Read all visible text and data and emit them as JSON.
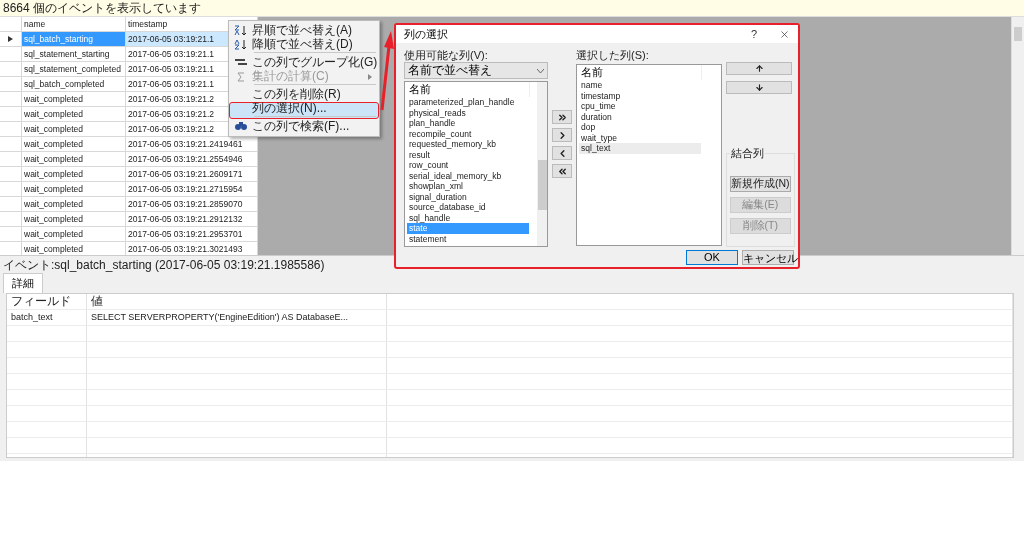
{
  "status_text": "8664 個のイベントを表示しています",
  "grid": {
    "columns": [
      "name",
      "timestamp"
    ],
    "rows": [
      {
        "name": "sql_batch_starting",
        "timestamp": "2017-06-05 03:19:21.1",
        "selected": true
      },
      {
        "name": "sql_statement_starting",
        "timestamp": "2017-06-05 03:19:21.1",
        "selected": false
      },
      {
        "name": "sql_statement_completed",
        "timestamp": "2017-06-05 03:19:21.1",
        "selected": false
      },
      {
        "name": "sql_batch_completed",
        "timestamp": "2017-06-05 03:19:21.1",
        "selected": false
      },
      {
        "name": "wait_completed",
        "timestamp": "2017-06-05 03:19:21.2",
        "selected": false
      },
      {
        "name": "wait_completed",
        "timestamp": "2017-06-05 03:19:21.2",
        "selected": false
      },
      {
        "name": "wait_completed",
        "timestamp": "2017-06-05 03:19:21.2",
        "selected": false
      },
      {
        "name": "wait_completed",
        "timestamp": "2017-06-05 03:19:21.2419461",
        "selected": false
      },
      {
        "name": "wait_completed",
        "timestamp": "2017-06-05 03:19:21.2554946",
        "selected": false
      },
      {
        "name": "wait_completed",
        "timestamp": "2017-06-05 03:19:21.2609171",
        "selected": false
      },
      {
        "name": "wait_completed",
        "timestamp": "2017-06-05 03:19:21.2715954",
        "selected": false
      },
      {
        "name": "wait_completed",
        "timestamp": "2017-06-05 03:19:21.2859070",
        "selected": false
      },
      {
        "name": "wait_completed",
        "timestamp": "2017-06-05 03:19:21.2912132",
        "selected": false
      },
      {
        "name": "wait_completed",
        "timestamp": "2017-06-05 03:19:21.2953701",
        "selected": false
      },
      {
        "name": "wait_completed",
        "timestamp": "2017-06-05 03:19:21.3021493",
        "selected": false
      }
    ]
  },
  "context_menu": {
    "items": [
      {
        "kind": "sort-asc",
        "label": "昇順で並べ替え(A)",
        "disabled": false,
        "selected": false,
        "submenu": false,
        "separator_after": false
      },
      {
        "kind": "sort-desc",
        "label": "降順で並べ替え(D)",
        "disabled": false,
        "selected": false,
        "submenu": false,
        "separator_after": true
      },
      {
        "kind": "group",
        "label": "この列でグループ化(G)",
        "disabled": false,
        "selected": false,
        "submenu": false,
        "separator_after": false
      },
      {
        "kind": "sum",
        "label": "集計の計算(C)",
        "disabled": true,
        "selected": false,
        "submenu": true,
        "separator_after": true
      },
      {
        "kind": "plain",
        "label": "この列を削除(R)",
        "disabled": false,
        "selected": false,
        "submenu": false,
        "separator_after": false
      },
      {
        "kind": "plain",
        "label": "列の選択(N)...",
        "disabled": false,
        "selected": true,
        "submenu": false,
        "separator_after": true
      },
      {
        "kind": "find",
        "label": "この列で検索(F)...",
        "disabled": false,
        "selected": false,
        "submenu": false,
        "separator_after": false
      }
    ]
  },
  "dialog": {
    "title": "列の選択",
    "help": "?",
    "available": {
      "label": "使用可能な列(V):",
      "sort": "名前で並べ替え",
      "header": "名前",
      "items": [
        {
          "label": "parameterized_plan_handle",
          "selected": false
        },
        {
          "label": "physical_reads",
          "selected": false
        },
        {
          "label": "plan_handle",
          "selected": false
        },
        {
          "label": "recompile_count",
          "selected": false
        },
        {
          "label": "requested_memory_kb",
          "selected": false
        },
        {
          "label": "result",
          "selected": false
        },
        {
          "label": "row_count",
          "selected": false
        },
        {
          "label": "serial_ideal_memory_kb",
          "selected": false
        },
        {
          "label": "showplan_xml",
          "selected": false
        },
        {
          "label": "signal_duration",
          "selected": false
        },
        {
          "label": "source_database_id",
          "selected": false
        },
        {
          "label": "sql_handle",
          "selected": false
        },
        {
          "label": "state",
          "selected": true
        },
        {
          "label": "statement",
          "selected": false
        }
      ]
    },
    "move_buttons": [
      {
        "kind": "add-all"
      },
      {
        "kind": "add"
      },
      {
        "kind": "remove"
      },
      {
        "kind": "remove-all"
      }
    ],
    "chosen": {
      "label": "選択した列(S):",
      "header": "名前",
      "items": [
        {
          "label": "name",
          "selected": false
        },
        {
          "label": "timestamp",
          "selected": false
        },
        {
          "label": "cpu_time",
          "selected": false
        },
        {
          "label": "duration",
          "selected": false
        },
        {
          "label": "dop",
          "selected": false
        },
        {
          "label": "wait_type",
          "selected": false
        },
        {
          "label": "sql_text",
          "selected": true
        }
      ]
    },
    "merged": {
      "label": "結合列",
      "buttons": [
        {
          "label": "新規作成(N)",
          "disabled": false
        },
        {
          "label": "編集(E)",
          "disabled": true
        },
        {
          "label": "削除(T)",
          "disabled": true
        }
      ]
    },
    "footer_buttons": [
      {
        "label": "OK",
        "default": true
      },
      {
        "label": "キャンセル",
        "default": false
      }
    ]
  },
  "details": {
    "caption": "イベント:sql_batch_starting (2017-06-05 03:19:21.1985586)",
    "tabs": [
      {
        "label": "詳細",
        "selected": true
      }
    ],
    "columns": [
      "フィールド",
      "値"
    ],
    "rows": [
      {
        "field": "batch_text",
        "value": "SELECT SERVERPROPERTY('EngineEdition') AS DatabaseE..."
      }
    ]
  }
}
